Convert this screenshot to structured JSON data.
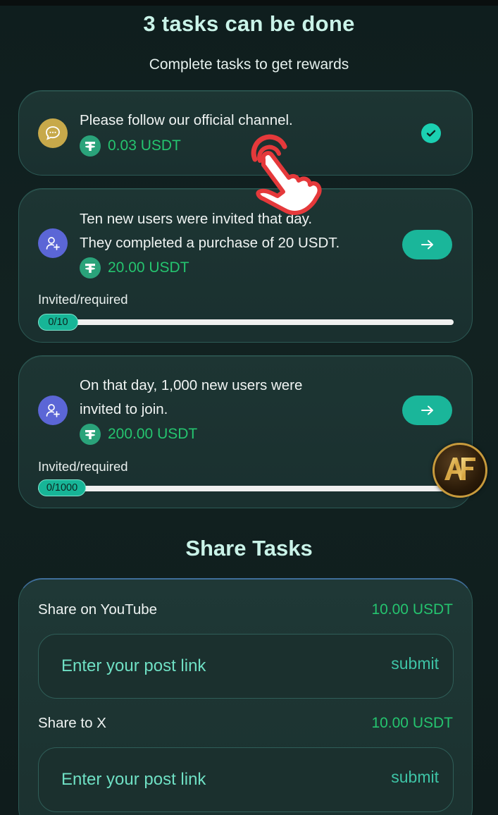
{
  "header": {
    "title": "3 tasks can be done",
    "subtitle": "Complete tasks to get rewards"
  },
  "tasks": [
    {
      "lines": [
        "Please follow our official channel."
      ],
      "reward": "0.03 USDT",
      "status": "completed",
      "icon": "chat-icon"
    },
    {
      "lines": [
        "Ten new users were invited that day.",
        "They completed a purchase of 20 USDT."
      ],
      "reward": "20.00 USDT",
      "progress_label": "Invited/required",
      "progress_text": "0/10",
      "progress": 0,
      "icon": "add-user-icon"
    },
    {
      "lines": [
        "On that day, 1,000 new users were",
        "invited to join."
      ],
      "reward": "200.00 USDT",
      "progress_label": "Invited/required",
      "progress_text": "0/1000",
      "progress": 0,
      "icon": "add-user-icon"
    }
  ],
  "share": {
    "title": "Share Tasks",
    "items": [
      {
        "label": "Share on YouTube",
        "reward": "10.00 USDT",
        "placeholder": "Enter your post link",
        "submit": "submit"
      },
      {
        "label": "Share to X",
        "reward": "10.00 USDT",
        "placeholder": "Enter your post link",
        "submit": "submit"
      }
    ]
  },
  "colors": {
    "background": "#122221",
    "accent": "#1ab69a",
    "reward_green": "#25c46f",
    "title": "#c9f3e8"
  }
}
